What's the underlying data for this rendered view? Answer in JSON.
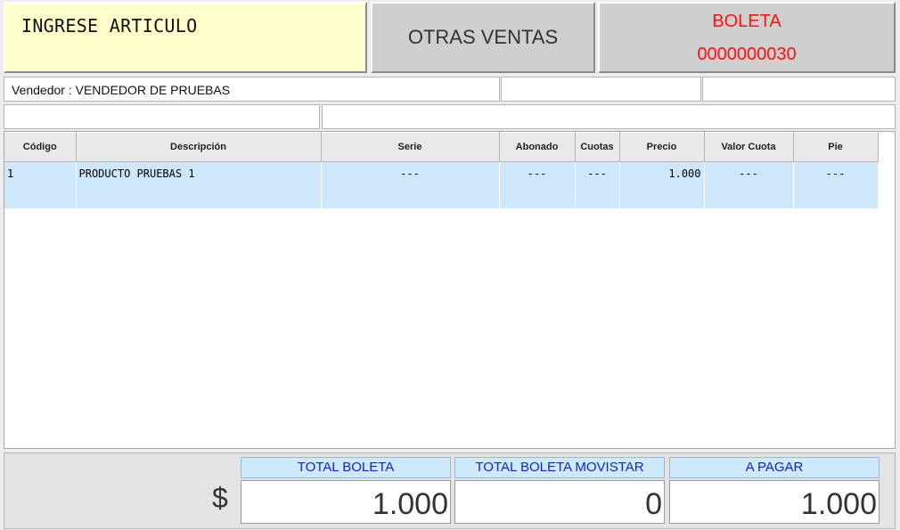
{
  "header": {
    "ingrese_label": "INGRESE ARTICULO",
    "otras_ventas_label": "OTRAS VENTAS",
    "boleta_label": "BOLETA",
    "boleta_number": "0000000030"
  },
  "info": {
    "vendedor": "Vendedor : VENDEDOR DE PRUEBAS"
  },
  "table": {
    "columns": [
      "Código",
      "Descripción",
      "Serie",
      "Abonado",
      "Cuotas",
      "Precio",
      "Valor Cuota",
      "Pie"
    ],
    "rows": [
      {
        "codigo": "1",
        "descripcion": "PRODUCTO PRUEBAS 1",
        "serie": "---",
        "abonado": "---",
        "cuotas": "---",
        "precio": "1.000",
        "valor_cuota": "---",
        "pie": "---"
      }
    ]
  },
  "totals": {
    "currency_symbol": "$",
    "total_boleta_label": "TOTAL BOLETA",
    "total_boleta_value": "1.000",
    "total_movistar_label": "TOTAL BOLETA MOVISTAR",
    "total_movistar_value": "0",
    "a_pagar_label": "A PAGAR",
    "a_pagar_value": "1.000"
  },
  "colors": {
    "ingrese_bg": "#ffffcc",
    "boleta_text": "#ff1111",
    "row_selected": "#cce8fa",
    "total_label_text": "#1523c9"
  }
}
